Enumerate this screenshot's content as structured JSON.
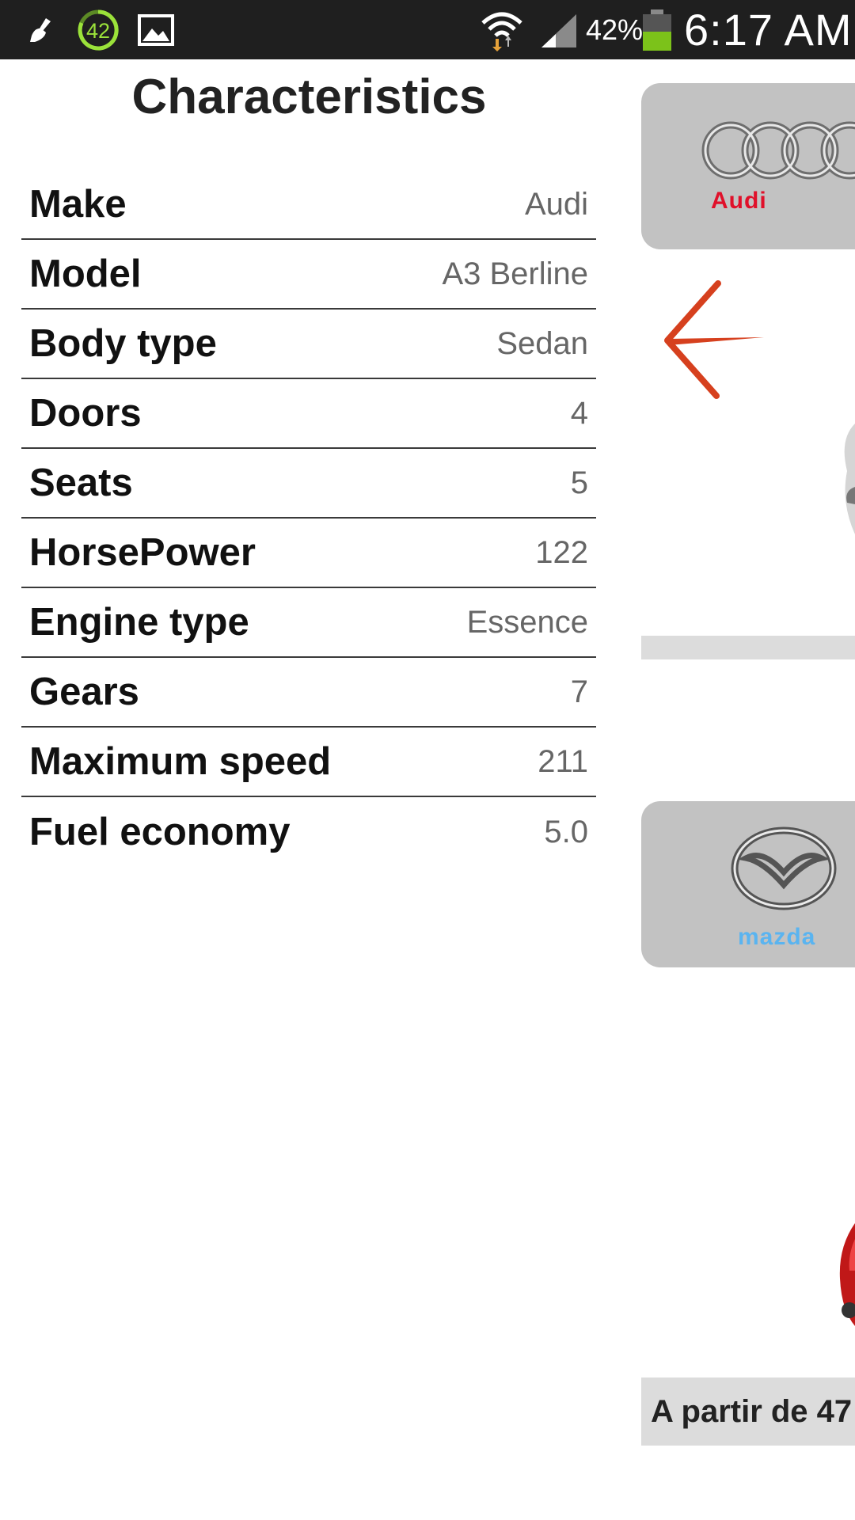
{
  "status_bar": {
    "notification_badge": "42",
    "battery_percent": "42%",
    "time": "6:17 AM",
    "icons": [
      "broom-icon",
      "badge-icon",
      "gallery-icon",
      "wifi-icon",
      "signal-icon",
      "battery-icon"
    ]
  },
  "characteristics": {
    "title": "Characteristics",
    "rows": [
      {
        "label": "Make",
        "value": "Audi"
      },
      {
        "label": "Model",
        "value": "A3 Berline"
      },
      {
        "label": "Body type",
        "value": "Sedan"
      },
      {
        "label": "Doors",
        "value": "4"
      },
      {
        "label": "Seats",
        "value": "5"
      },
      {
        "label": "HorsePower",
        "value": "122"
      },
      {
        "label": "Engine type",
        "value": "Essence"
      },
      {
        "label": "Gears",
        "value": "7"
      },
      {
        "label": "Maximum speed",
        "value": "211"
      },
      {
        "label": "Fuel economy",
        "value": "5.0"
      }
    ]
  },
  "carousel": {
    "audi_logo_text": "Audi",
    "mazda_logo_text": "mazda",
    "price_text": "A partir de 47"
  },
  "colors": {
    "status_bar_bg": "#1f1f1f",
    "arrow": "#d6401e",
    "logo_card_bg": "#c2c2c2",
    "audi_red": "#e0102a",
    "mazda_blue": "#5ab4f0"
  }
}
